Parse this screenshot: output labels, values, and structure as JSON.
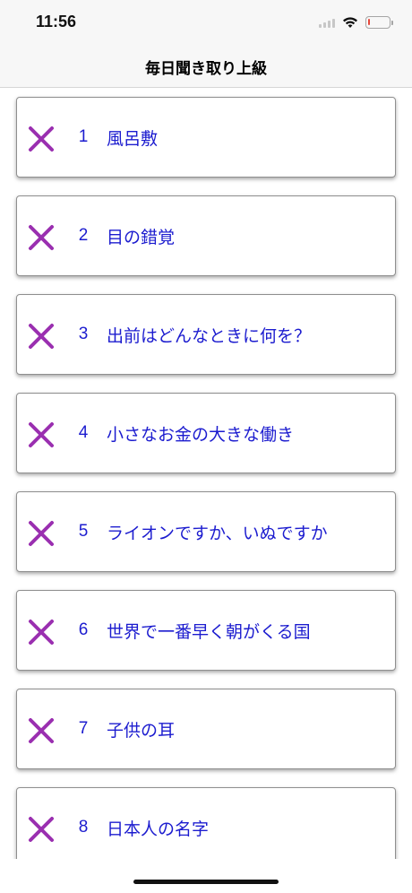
{
  "status_bar": {
    "time": "11:56",
    "battery_level": 0.1,
    "battery_color": "#e5483b"
  },
  "header": {
    "title": "毎日聞き取り上級"
  },
  "colors": {
    "text_blue": "#1c1ccf",
    "x_purple": "#9a2fb0"
  },
  "lessons": [
    {
      "number": "1",
      "title": "風呂敷",
      "status_icon": "x-mark-icon"
    },
    {
      "number": "2",
      "title": "目の錯覚",
      "status_icon": "x-mark-icon"
    },
    {
      "number": "3",
      "title": "出前はどんなときに何を？",
      "status_icon": "x-mark-icon"
    },
    {
      "number": "4",
      "title": "小さなお金の大きな働き",
      "status_icon": "x-mark-icon"
    },
    {
      "number": "5",
      "title": "ライオンですか、いぬですか",
      "status_icon": "x-mark-icon"
    },
    {
      "number": "6",
      "title": "世界で一番早く朝がくる国",
      "status_icon": "x-mark-icon"
    },
    {
      "number": "7",
      "title": "子供の耳",
      "status_icon": "x-mark-icon"
    },
    {
      "number": "8",
      "title": "日本人の名字",
      "status_icon": "x-mark-icon"
    }
  ]
}
